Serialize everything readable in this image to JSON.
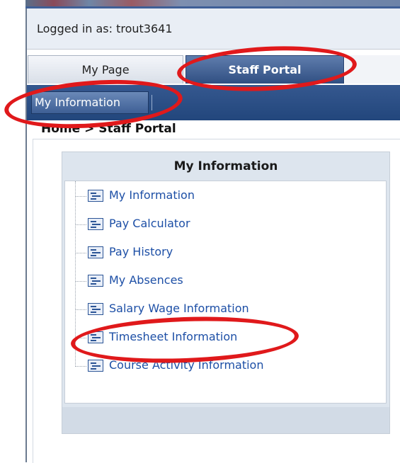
{
  "header": {
    "logged_in_text": "Logged in as: trout3641"
  },
  "tabs": [
    {
      "label": "My Page",
      "active": false
    },
    {
      "label": "Staff Portal",
      "active": true
    }
  ],
  "subnav": {
    "active_label": "My Information"
  },
  "breadcrumb": "Home > Staff Portal",
  "panel": {
    "title": "My Information",
    "items": [
      {
        "label": "My Information",
        "icon": "list-document-icon"
      },
      {
        "label": "Pay Calculator",
        "icon": "list-document-icon"
      },
      {
        "label": "Pay History",
        "icon": "list-document-icon"
      },
      {
        "label": "My Absences",
        "icon": "list-document-icon"
      },
      {
        "label": "Salary Wage Information",
        "icon": "list-document-icon"
      },
      {
        "label": "Timesheet Information",
        "icon": "list-document-icon"
      },
      {
        "label": "Course Activity Information",
        "icon": "list-document-icon"
      }
    ]
  },
  "colors": {
    "annotation_red": "#e0191b",
    "link_blue": "#1d4fa6",
    "nav_blue": "#2a4d85"
  }
}
